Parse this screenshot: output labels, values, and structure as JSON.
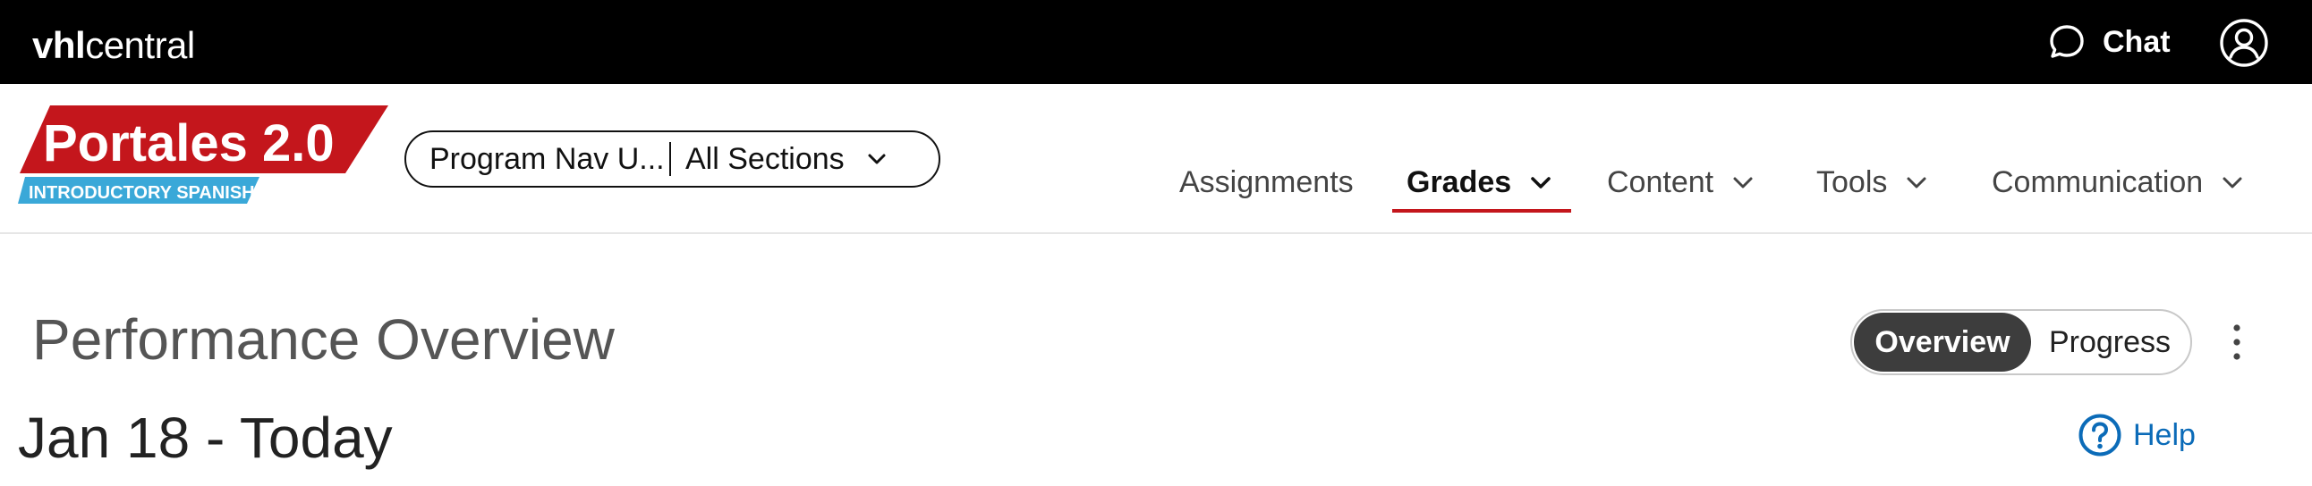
{
  "topbar": {
    "logo_bold": "vhl",
    "logo_rest": "central",
    "chat_label": "Chat",
    "chat_icon": "chat-bubble-icon",
    "account_icon": "user-account-icon"
  },
  "brand": {
    "title": "Portales 2.0",
    "subtitle": "INTRODUCTORY SPANISH",
    "colors": {
      "red": "#c4161c",
      "blue": "#3aa8d8"
    }
  },
  "section_selector": {
    "program": "Program Nav U...",
    "section": "All Sections"
  },
  "nav": {
    "items": [
      {
        "label": "Assignments",
        "has_dropdown": false,
        "active": false
      },
      {
        "label": "Grades",
        "has_dropdown": true,
        "active": true
      },
      {
        "label": "Content",
        "has_dropdown": true,
        "active": false
      },
      {
        "label": "Tools",
        "has_dropdown": true,
        "active": false
      },
      {
        "label": "Communication",
        "has_dropdown": true,
        "active": false
      }
    ],
    "active_underline_color": "#c4161c"
  },
  "page": {
    "title": "Performance Overview",
    "date_range": "Jan 18 - Today",
    "view_toggle": {
      "selected": "Overview",
      "options": [
        "Overview",
        "Progress"
      ]
    },
    "help_label": "Help",
    "help_color": "#0b6bb8"
  }
}
